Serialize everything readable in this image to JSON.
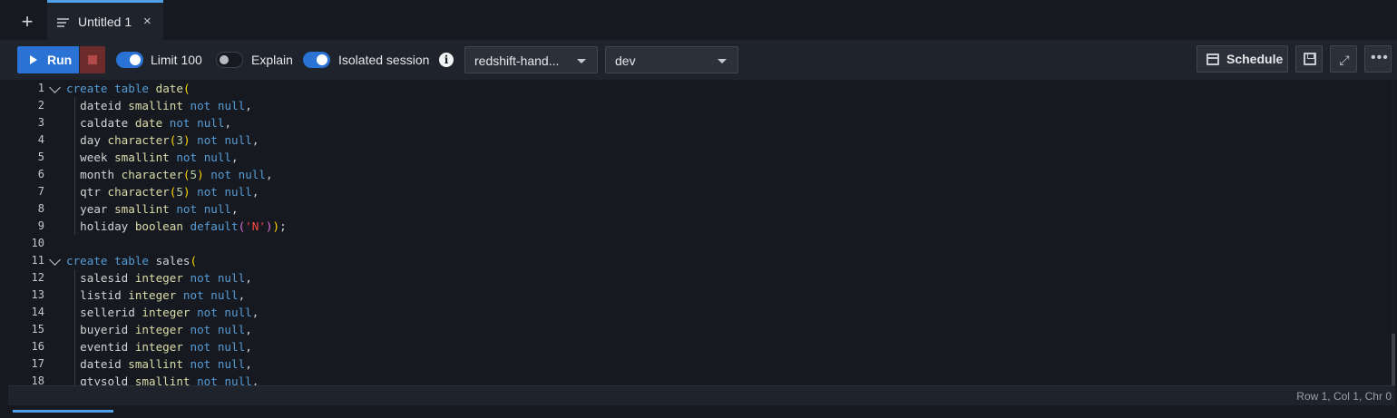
{
  "tabs": [
    {
      "label": "Untitled 1",
      "close": "×",
      "icon": "document-lines-icon"
    }
  ],
  "tab_add_label": "+",
  "toolbar": {
    "run_label": "Run",
    "limit_label": "Limit 100",
    "limit_on": true,
    "explain_label": "Explain",
    "explain_on": false,
    "isolated_label": "Isolated session",
    "isolated_on": true,
    "info_glyph": "i",
    "connection_value": "redshift-hand...",
    "database_value": "dev",
    "schedule_label": "Schedule",
    "more_glyph": "•••"
  },
  "editor": {
    "lines": [
      "create table date(",
      "  dateid smallint not null,",
      "  caldate date not null,",
      "  day character(3) not null,",
      "  week smallint not null,",
      "  month character(5) not null,",
      "  qtr character(5) not null,",
      "  year smallint not null,",
      "  holiday boolean default('N'));",
      "",
      "create table sales(",
      "  salesid integer not null,",
      "  listid integer not null,",
      "  sellerid integer not null,",
      "  buyerid integer not null,",
      "  eventid integer not null,",
      "  dateid smallint not null,",
      "  qtysold smallint not null,"
    ],
    "fold_lines": [
      1,
      11
    ]
  },
  "status": {
    "position": "Row 1,  Col 1,  Chr 0"
  },
  "colors": {
    "accent": "#2a72d4",
    "keyword": "#569cd6",
    "type": "#dcdcaa",
    "string": "#f44747",
    "bracket1": "#ffd700",
    "bracket2": "#da70d6"
  }
}
